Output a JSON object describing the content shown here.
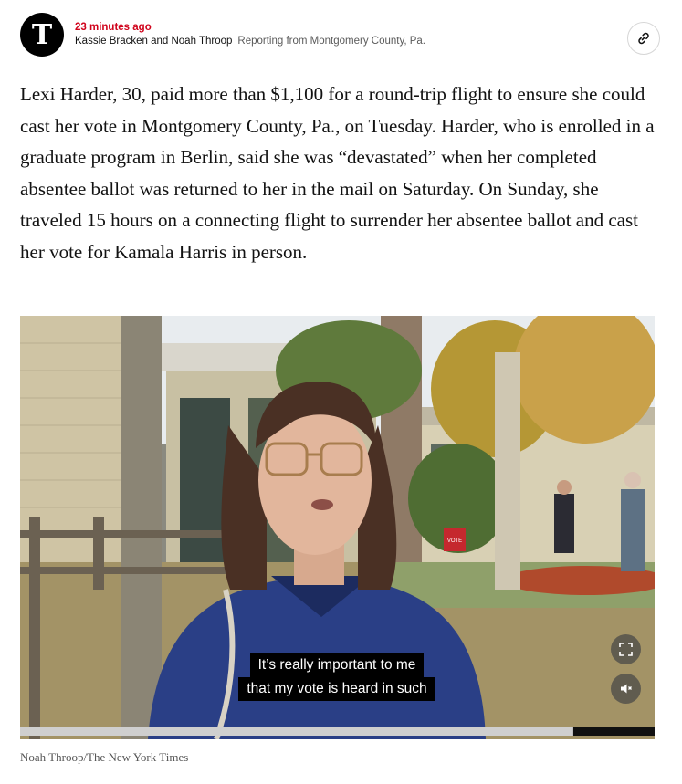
{
  "header": {
    "logo_text": "T",
    "timestamp": "23 minutes ago",
    "authors": "Kassie Bracken and Noah Throop",
    "location": "Reporting from Montgomery County, Pa.",
    "link_icon": "link-icon"
  },
  "article": {
    "paragraph": "Lexi Harder, 30, paid more than $1,100 for a round-trip flight to ensure she could cast her vote in Montgomery County, Pa., on Tuesday. Harder, who is enrolled in a graduate program in Berlin, said she was “devastated” when her completed absentee ballot was returned to her in the mail on Saturday. On Sunday, she traveled 15 hours on a connecting flight to surrender her absentee ballot and cast her vote for Kamala Harris in person."
  },
  "video": {
    "captions": [
      "It’s really important to me",
      "that my vote is heard in such"
    ],
    "sign_text": "VOTE",
    "fullscreen_icon": "fullscreen-icon",
    "mute_icon": "mute-icon",
    "progress_fraction": 0.87,
    "credit": "Noah Throop/The New York Times"
  },
  "colors": {
    "timestamp": "#d0021b",
    "text": "#121212",
    "muted": "#5a5a5a"
  }
}
